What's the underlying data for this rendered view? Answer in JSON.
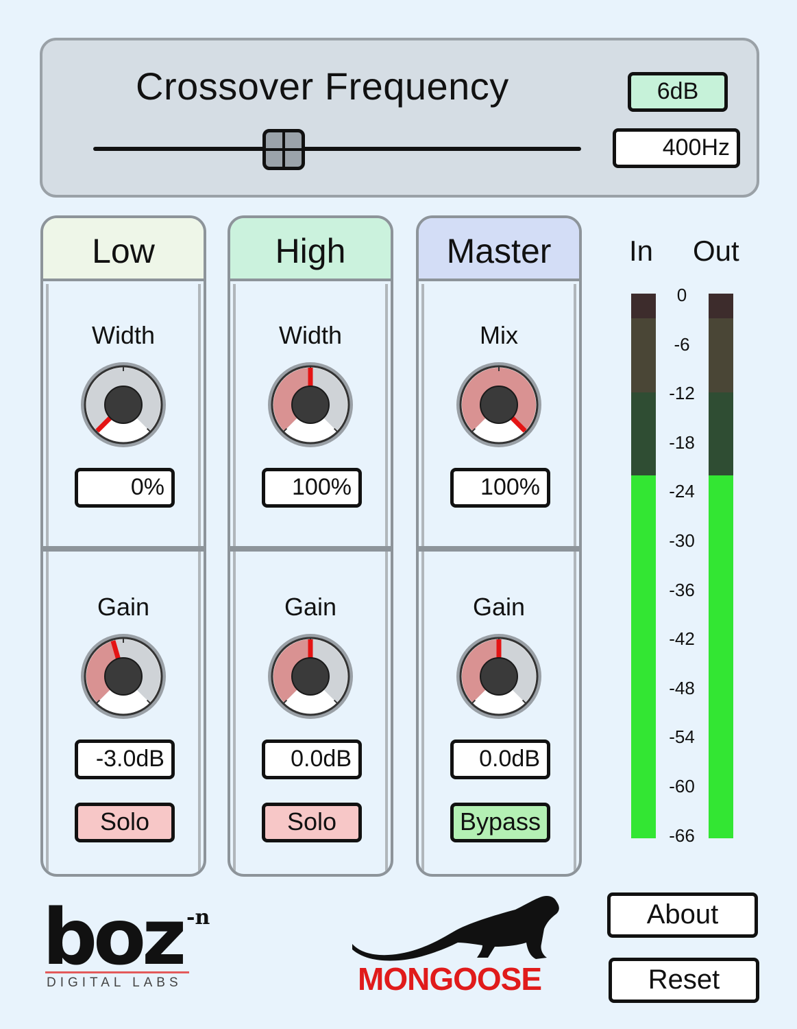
{
  "crossover": {
    "title": "Crossover Frequency",
    "slope": "6dB",
    "frequency": "400Hz",
    "slider_position": 0.39
  },
  "bands": [
    {
      "name": "Low",
      "header_color": "#eef6e8",
      "top_param": {
        "label": "Width",
        "value": "0%",
        "level": 0.0
      },
      "gain": {
        "label": "Gain",
        "value": "-3.0dB",
        "level": 0.44
      },
      "button": {
        "label": "Solo",
        "style": "solo"
      }
    },
    {
      "name": "High",
      "header_color": "#cbf2dd",
      "top_param": {
        "label": "Width",
        "value": "100%",
        "level": 0.5
      },
      "gain": {
        "label": "Gain",
        "value": "0.0dB",
        "level": 0.5
      },
      "button": {
        "label": "Solo",
        "style": "solo"
      }
    },
    {
      "name": "Master",
      "header_color": "#d3ddf6",
      "top_param": {
        "label": "Mix",
        "value": "100%",
        "level": 1.0
      },
      "gain": {
        "label": "Gain",
        "value": "0.0dB",
        "level": 0.5
      },
      "button": {
        "label": "Bypass",
        "style": "bypass"
      }
    }
  ],
  "meters": {
    "in_label": "In",
    "out_label": "Out",
    "scale": [
      "0",
      "-6",
      "-12",
      "-18",
      "-24",
      "-30",
      "-36",
      "-42",
      "-48",
      "-54",
      "-60",
      "-66"
    ],
    "in_level_db": -22,
    "out_level_db": -22,
    "colors": {
      "active": "#33e633",
      "green_dim": "#2f4d33",
      "yellow_dim": "#4a4636",
      "red_dim": "#3d2c2c"
    }
  },
  "buttons": {
    "about": "About",
    "reset": "Reset"
  },
  "brand": {
    "boz": "boz",
    "boz_sup": "-n",
    "boz_sub": "DIGITAL LABS",
    "product": "MONGOOSE"
  },
  "colors": {
    "knob_active": "#d99292",
    "knob_inactive": "#cfd3d7",
    "pointer": "#e41414"
  }
}
